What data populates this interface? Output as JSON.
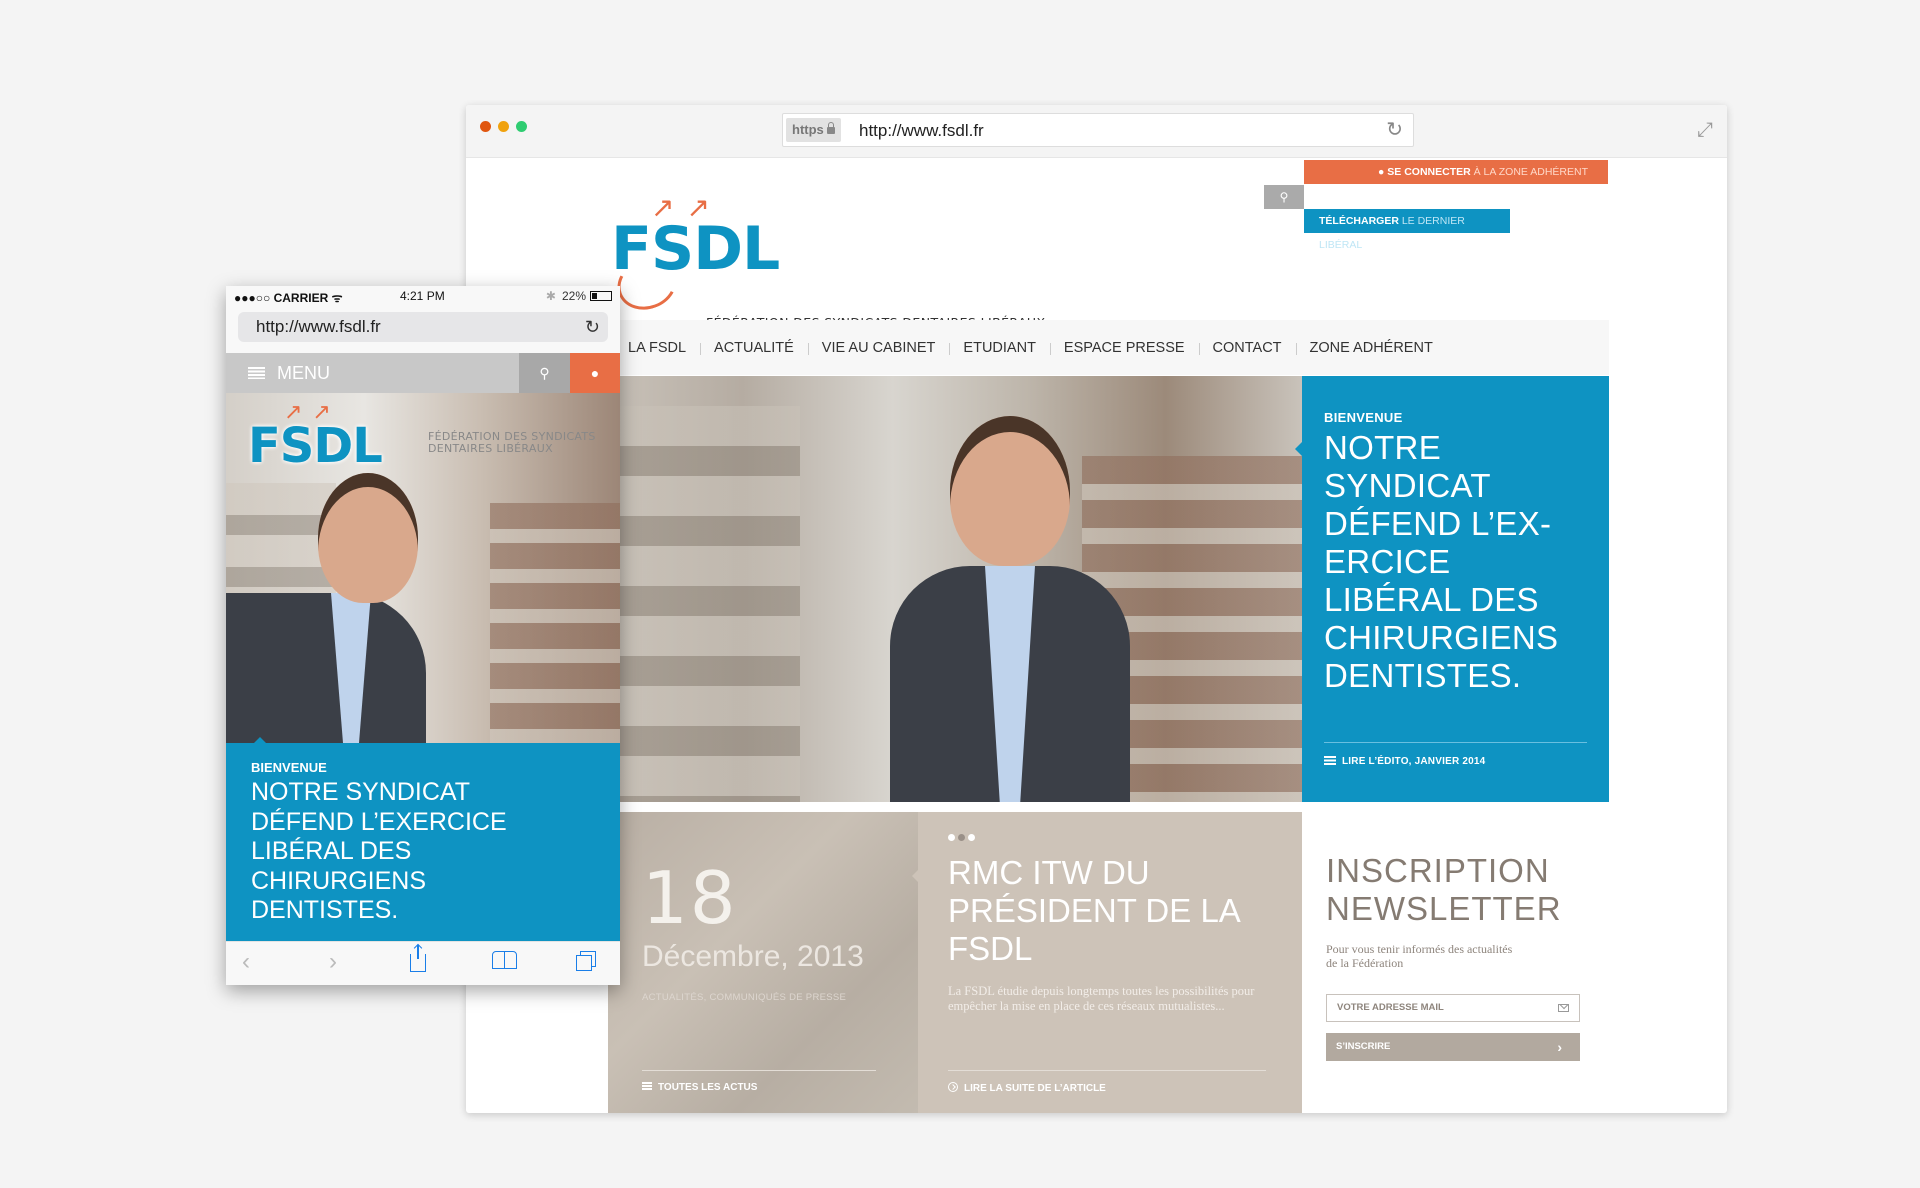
{
  "desktop": {
    "browser": {
      "https_label": "https",
      "url": "http://www.fsdl.fr",
      "reload_icon": "reload-icon",
      "expand_icon": "expand-icon"
    },
    "header": {
      "logo_text": "FSDL",
      "logo_arrows": "↗↗",
      "logo_subtitle": "FÉDÉRATION DES SYNDICATS DENTAIRES LIBÉRAUX",
      "login_bold": "SE CONNECTER",
      "login_rest": " À LA ZONE ADHÉRENT",
      "download_bold": "TÉLÉCHARGER",
      "download_rest": "  LE DERNIER LIBÉRAL",
      "search_icon": "⚲",
      "user_icon": "👤"
    },
    "nav": [
      {
        "label": "LA FSDL"
      },
      {
        "label": "ACTUALITÉ"
      },
      {
        "label": "VIE AU CABINET"
      },
      {
        "label": "ETUDIANT"
      },
      {
        "label": "ESPACE PRESSE"
      },
      {
        "label": "CONTACT"
      },
      {
        "label": "ZONE ADHÉRENT"
      }
    ],
    "welcome": {
      "kicker": "BIENVENUE",
      "headline": "NOTRE SYNDICAT DÉFEND L’EX-ERCICE LIBÉRAL DES CHIRURGIENS DENTISTES.",
      "edito_link": "LIRE L’ÉDITO, JANVIER 2014"
    },
    "news_date": {
      "day": "18",
      "month_year": "Décembre, 2013",
      "categories": "ACTUALITÉS, COMMUNIQUÉS DE PRESSE",
      "all_link": "TOUTES LES ACTUS"
    },
    "news_article": {
      "slide_count": 3,
      "active_slide": 2,
      "title": "RMC ITW DU PRÉSIDENT DE LA FSDL",
      "excerpt": "La FSDL étudie depuis longtemps toutes les possibilités pour empêcher la mise en place de ces réseaux mutualistes...",
      "more_link": "LIRE LA SUITE  DE L’ARTICLE"
    },
    "newsletter": {
      "title": "INSCRIPTION NEWSLETTER",
      "description": "Pour vous tenir informés des actualités de la Fédération",
      "email_placeholder": "VOTRE ADRESSE MAIL",
      "submit_label": "S’INSCRIRE",
      "submit_chevron": "›"
    }
  },
  "mobile": {
    "status": {
      "carrier": "●●●○○ CARRIER ᯤ",
      "time": "4:21 PM",
      "bluetooth": "✱",
      "battery": "22%"
    },
    "url": "http://www.fsdl.fr",
    "menu_label": "MENU",
    "logo_text": "FSDL",
    "logo_arrows": "↗↗",
    "logo_subtitle": "FÉDÉRATION DES SYNDICATS DENTAIRES LIBÉRAUX",
    "welcome": {
      "kicker": "BIENVENUE",
      "headline": "NOTRE SYNDICAT DÉFEND L’EXERCICE LIBÉRAL DES CHIRURGIENS DENTISTES."
    },
    "toolbar": {
      "back": "‹",
      "forward": "›"
    }
  },
  "colors": {
    "brand_blue": "#0e93c2",
    "brand_orange": "#e86e45",
    "news_taupe": "#cdc3b8",
    "newsletter_text": "#857b72"
  }
}
